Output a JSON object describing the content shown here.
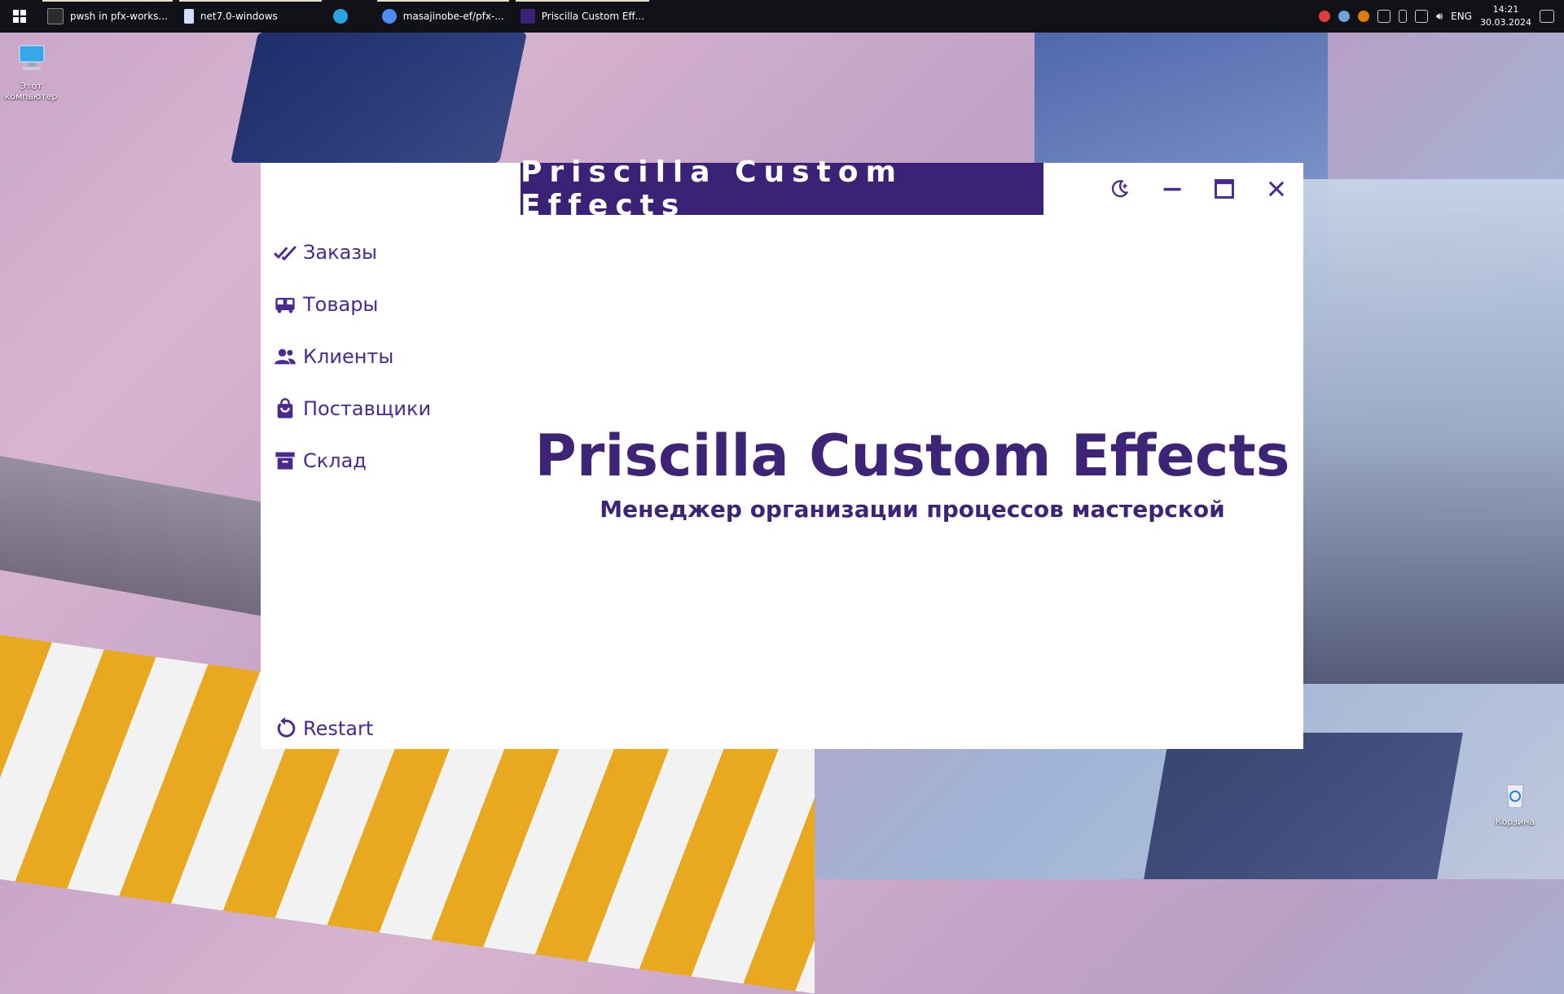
{
  "taskbar": {
    "tasks": [
      {
        "label": "pwsh in pfx-works...",
        "icon": "terminal-icon",
        "active": true
      },
      {
        "label": "net7.0-windows",
        "icon": "folder-icon",
        "active": true
      },
      {
        "label": "",
        "icon": "telegram-icon",
        "active": false
      },
      {
        "label": "masajinobe-ef/pfx-...",
        "icon": "browser-icon",
        "active": true
      },
      {
        "label": "Priscilla Custom Eff...",
        "icon": "app-icon",
        "active": true
      }
    ],
    "language": "ENG",
    "time": "14:21",
    "date": "30.03.2024"
  },
  "desktop": {
    "this_pc": "Этот компьютер",
    "recycle_bin": "Корзина"
  },
  "app": {
    "title": "Priscilla Custom Effects",
    "nav": [
      {
        "label": "Заказы",
        "icon": "double-check-icon"
      },
      {
        "label": "Товары",
        "icon": "bus-icon"
      },
      {
        "label": "Клиенты",
        "icon": "users-icon"
      },
      {
        "label": "Поставщики",
        "icon": "shopping-bag-icon"
      },
      {
        "label": "Склад",
        "icon": "archive-icon"
      }
    ],
    "restart_label": "Restart",
    "hero_title": "Priscilla Custom Effects",
    "hero_subtitle": "Менеджер организации процессов мастерской"
  },
  "colors": {
    "accent": "#3b2277",
    "nav_text": "#4b2a8f",
    "taskbar": "#111217"
  }
}
